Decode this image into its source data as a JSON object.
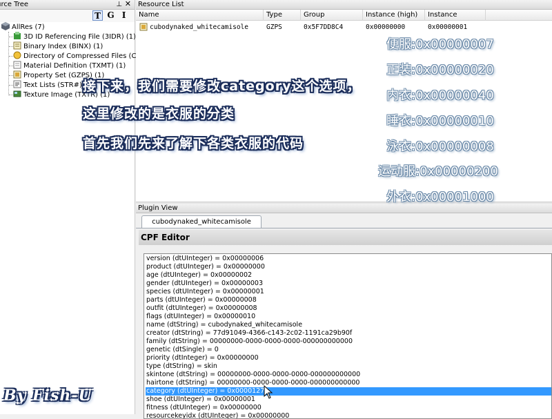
{
  "tree": {
    "title": "ource Tree",
    "pin_glyph": "⊥",
    "close_glyph": "✕",
    "toolbar": [
      "T",
      "G",
      "I"
    ],
    "root": "AllRes (7)",
    "items": [
      {
        "label": "3D ID Referencing File (3IDR) (1)",
        "icon": "3idr-icon"
      },
      {
        "label": "Binary Index (BINX) (1)",
        "icon": "binx-icon"
      },
      {
        "label": "Directory of Compressed Files (CLST) (1)",
        "icon": "clst-icon"
      },
      {
        "label": "Material Definition (TXMT) (1)",
        "icon": "txmt-icon"
      },
      {
        "label": "Property Set (GZPS) (1)",
        "icon": "gzps-icon"
      },
      {
        "label": "Text Lists (STR#) (1)",
        "icon": "str-icon"
      },
      {
        "label": "Texture Image (TXTR) (1)",
        "icon": "txtr-icon"
      }
    ]
  },
  "resource_list": {
    "title": "Resource List",
    "columns": [
      "Name",
      "Type",
      "Group",
      "Instance (high)",
      "Instance"
    ],
    "rows": [
      {
        "name": "cubodynaked_whitecamisole",
        "type": "GZPS",
        "group": "0x5F7DD8C4",
        "instance_high": "0x00000000",
        "instance": "0x00000001"
      }
    ]
  },
  "plugin": {
    "title": "Plugin View",
    "tab": "cubodynaked_whitecamisole",
    "editor_title": "CPF Editor",
    "items": [
      "version (dtUInteger) = 0x00000006",
      "product (dtUInteger) = 0x00000000",
      "age (dtUInteger) = 0x00000002",
      "gender (dtUInteger) = 0x00000003",
      "species (dtUInteger) = 0x00000001",
      "parts (dtUInteger) = 0x00000008",
      "outfit (dtUInteger) = 0x00000008",
      "flags (dtUInteger) = 0x00000010",
      "name (dtString) = cubodynaked_whitecamisole",
      "creator (dtString) = 77d91049-4366-c143-2c02-1191ca29b90f",
      "family (dtString) = 00000000-0000-0000-0000-000000000000",
      "genetic (dtSingle) = 0",
      "priority (dtInteger) = 0x00000000",
      "type (dtString) = skin",
      "skintone (dtString) = 00000000-0000-0000-0000-000000000000",
      "hairtone (dtString) = 00000000-0000-0000-0000-000000000000",
      "category (dtUInteger) = 0x0000127F",
      "shoe (dtUInteger) = 0x00000001",
      "fitness (dtUInteger) = 0x00000000",
      "resourcekeyidx (dtUInteger) = 0x00000000"
    ],
    "selected_index": 16
  },
  "annotations": {
    "lines": [
      "接下来，我们需要修改category这个选项，",
      "这里修改的是衣服的分类",
      "首先我们先来了解下各类衣服的代码"
    ],
    "codes": [
      "便服:0x00000007",
      "正装:0x00000020",
      "内衣:0x00000040",
      "睡衣:0x00000010",
      "泳衣:0x00000008",
      "运动服:0x00000200",
      "外衣:0x00001000"
    ],
    "signature": "By Fish-U"
  },
  "colors": {
    "selection": "#3399ff",
    "note_outline": "#1b2d5a",
    "code_outline": "#6a89a8"
  }
}
